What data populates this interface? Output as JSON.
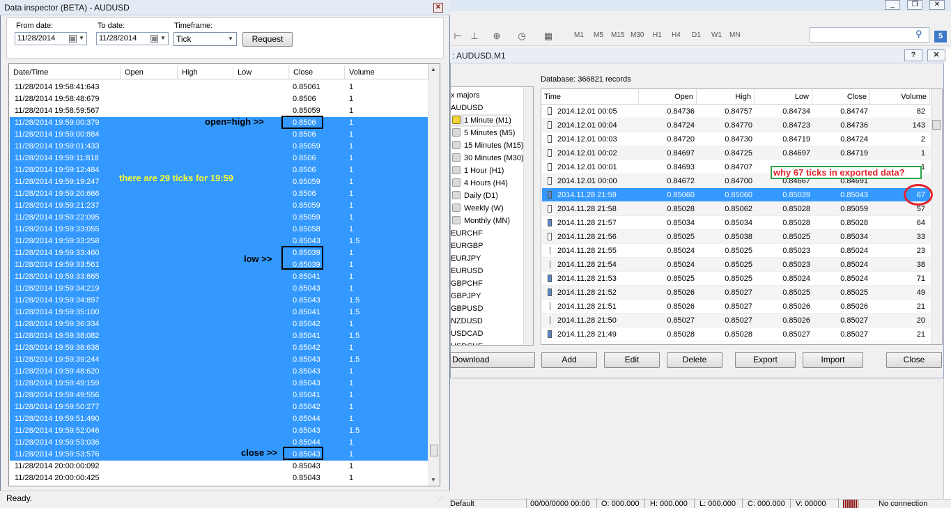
{
  "inspector": {
    "title": "Data inspector (BETA) -  AUDUSD",
    "from_label": "From date:",
    "from_value": "11/28/2014",
    "to_label": "To date:",
    "to_value": "11/28/2014",
    "timeframe_label": "Timeframe:",
    "timeframe_value": "Tick",
    "request_label": "Request",
    "columns": [
      "Date/Time",
      "Open",
      "High",
      "Low",
      "Close",
      "Volume"
    ],
    "rows": [
      {
        "time": "11/28/2014 19:58:41:643",
        "close": "0.85061",
        "volume": "1",
        "selected": false
      },
      {
        "time": "11/28/2014 19:58:48:679",
        "close": "0.8506",
        "volume": "1",
        "selected": false
      },
      {
        "time": "11/28/2014 19:58:59:567",
        "close": "0.85059",
        "volume": "1",
        "selected": false
      },
      {
        "time": "11/28/2014 19:59:00:379",
        "close": "0.8506",
        "volume": "1",
        "selected": true
      },
      {
        "time": "11/28/2014 19:59:00:884",
        "close": "0.8506",
        "volume": "1",
        "selected": true
      },
      {
        "time": "11/28/2014 19:59:01:433",
        "close": "0.85059",
        "volume": "1",
        "selected": true
      },
      {
        "time": "11/28/2014 19:59:11:818",
        "close": "0.8506",
        "volume": "1",
        "selected": true
      },
      {
        "time": "11/28/2014 19:59:12:484",
        "close": "0.8506",
        "volume": "1",
        "selected": true
      },
      {
        "time": "11/28/2014 19:59:19:247",
        "close": "0.85059",
        "volume": "1",
        "selected": true
      },
      {
        "time": "11/28/2014 19:59:20:666",
        "close": "0.8506",
        "volume": "1",
        "selected": true
      },
      {
        "time": "11/28/2014 19:59:21:237",
        "close": "0.85059",
        "volume": "1",
        "selected": true
      },
      {
        "time": "11/28/2014 19:59:22:095",
        "close": "0.85059",
        "volume": "1",
        "selected": true
      },
      {
        "time": "11/28/2014 19:59:33:055",
        "close": "0.85058",
        "volume": "1",
        "selected": true
      },
      {
        "time": "11/28/2014 19:59:33:258",
        "close": "0.85043",
        "volume": "1.5",
        "selected": true
      },
      {
        "time": "11/28/2014 19:59:33:460",
        "close": "0.85039",
        "volume": "1",
        "selected": true
      },
      {
        "time": "11/28/2014 19:59:33:561",
        "close": "0.85039",
        "volume": "1",
        "selected": true
      },
      {
        "time": "11/28/2014 19:59:33:865",
        "close": "0.85041",
        "volume": "1",
        "selected": true
      },
      {
        "time": "11/28/2014 19:59:34:219",
        "close": "0.85043",
        "volume": "1",
        "selected": true
      },
      {
        "time": "11/28/2014 19:59:34:897",
        "close": "0.85043",
        "volume": "1.5",
        "selected": true
      },
      {
        "time": "11/28/2014 19:59:35:100",
        "close": "0.85041",
        "volume": "1.5",
        "selected": true
      },
      {
        "time": "11/28/2014 19:59:36:334",
        "close": "0.85042",
        "volume": "1",
        "selected": true
      },
      {
        "time": "11/28/2014 19:59:38:082",
        "close": "0.85041",
        "volume": "1.5",
        "selected": true
      },
      {
        "time": "11/28/2014 19:59:38:638",
        "close": "0.85042",
        "volume": "1",
        "selected": true
      },
      {
        "time": "11/28/2014 19:59:39:244",
        "close": "0.85043",
        "volume": "1.5",
        "selected": true
      },
      {
        "time": "11/28/2014 19:59:48:620",
        "close": "0.85043",
        "volume": "1",
        "selected": true
      },
      {
        "time": "11/28/2014 19:59:49:159",
        "close": "0.85043",
        "volume": "1",
        "selected": true
      },
      {
        "time": "11/28/2014 19:59:49:556",
        "close": "0.85041",
        "volume": "1",
        "selected": true
      },
      {
        "time": "11/28/2014 19:59:50:277",
        "close": "0.85042",
        "volume": "1",
        "selected": true
      },
      {
        "time": "11/28/2014 19:59:51:490",
        "close": "0.85044",
        "volume": "1",
        "selected": true
      },
      {
        "time": "11/28/2014 19:59:52:046",
        "close": "0.85043",
        "volume": "1.5",
        "selected": true
      },
      {
        "time": "11/28/2014 19:59:53:036",
        "close": "0.85044",
        "volume": "1",
        "selected": true
      },
      {
        "time": "11/28/2014 19:59:53:576",
        "close": "0.85043",
        "volume": "1",
        "selected": true
      },
      {
        "time": "11/28/2014 20:00:00:092",
        "close": "0.85043",
        "volume": "1",
        "selected": false
      },
      {
        "time": "11/28/2014 20:00:00:425",
        "close": "0.85043",
        "volume": "1",
        "selected": false
      }
    ],
    "annotations": {
      "open_high": "open=high  >>",
      "ticks_note": "there are 29 ticks for 19:59",
      "low": "low >>",
      "close": "close >>"
    },
    "status": "Ready."
  },
  "history": {
    "title": ": AUDUSD,M1",
    "help_label": "?",
    "close_x": "✕",
    "db_info": "Database: 366821 records",
    "tree": [
      {
        "label": "x majors",
        "icon": false,
        "active": false,
        "selected": false
      },
      {
        "label": "AUDUSD",
        "icon": false,
        "active": false,
        "selected": false
      },
      {
        "label": "1 Minute (M1)",
        "icon": true,
        "active": true,
        "selected": true
      },
      {
        "label": "5 Minutes (M5)",
        "icon": true,
        "active": false,
        "selected": false
      },
      {
        "label": "15 Minutes (M15)",
        "icon": true,
        "active": false,
        "selected": false
      },
      {
        "label": "30 Minutes (M30)",
        "icon": true,
        "active": false,
        "selected": false
      },
      {
        "label": "1 Hour (H1)",
        "icon": true,
        "active": false,
        "selected": false
      },
      {
        "label": "4 Hours (H4)",
        "icon": true,
        "active": false,
        "selected": false
      },
      {
        "label": "Daily (D1)",
        "icon": true,
        "active": false,
        "selected": false
      },
      {
        "label": "Weekly (W)",
        "icon": true,
        "active": false,
        "selected": false
      },
      {
        "label": "Monthly (MN)",
        "icon": true,
        "active": false,
        "selected": false
      },
      {
        "label": "EURCHF",
        "icon": false,
        "active": false,
        "selected": false
      },
      {
        "label": "EURGBP",
        "icon": false,
        "active": false,
        "selected": false
      },
      {
        "label": "EURJPY",
        "icon": false,
        "active": false,
        "selected": false
      },
      {
        "label": "EURUSD",
        "icon": false,
        "active": false,
        "selected": false
      },
      {
        "label": "GBPCHF",
        "icon": false,
        "active": false,
        "selected": false
      },
      {
        "label": "GBPJPY",
        "icon": false,
        "active": false,
        "selected": false
      },
      {
        "label": "GBPUSD",
        "icon": false,
        "active": false,
        "selected": false
      },
      {
        "label": "NZDUSD",
        "icon": false,
        "active": false,
        "selected": false
      },
      {
        "label": "USDCAD",
        "icon": false,
        "active": false,
        "selected": false
      },
      {
        "label": "USDCHF",
        "icon": false,
        "active": false,
        "selected": false
      }
    ],
    "columns": [
      "Time",
      "Open",
      "High",
      "Low",
      "Close",
      "Volume"
    ],
    "rows": [
      {
        "time": "2014.12.01 00:05",
        "open": "0.84736",
        "high": "0.84757",
        "low": "0.84734",
        "close": "0.84747",
        "volume": "82",
        "candle": "up"
      },
      {
        "time": "2014.12.01 00:04",
        "open": "0.84724",
        "high": "0.84770",
        "low": "0.84723",
        "close": "0.84736",
        "volume": "143",
        "candle": "up"
      },
      {
        "time": "2014.12.01 00:03",
        "open": "0.84720",
        "high": "0.84730",
        "low": "0.84719",
        "close": "0.84724",
        "volume": "2",
        "candle": "up"
      },
      {
        "time": "2014.12.01 00:02",
        "open": "0.84697",
        "high": "0.84725",
        "low": "0.84697",
        "close": "0.84719",
        "volume": "1",
        "candle": "up"
      },
      {
        "time": "2014.12.01 00:01",
        "open": "0.84693",
        "high": "0.84707",
        "low": "",
        "close": "",
        "volume": "1",
        "candle": "up"
      },
      {
        "time": "2014.12.01 00:00",
        "open": "0.84672",
        "high": "0.84700",
        "low": "0.84667",
        "close": "0.84691",
        "volume": "",
        "candle": "up"
      },
      {
        "time": "2014.11.28 21:59",
        "open": "0.85060",
        "high": "0.85060",
        "low": "0.85039",
        "close": "0.85043",
        "volume": "67",
        "candle": "dark",
        "selected": true
      },
      {
        "time": "2014.11.28 21:58",
        "open": "0.85028",
        "high": "0.85062",
        "low": "0.85028",
        "close": "0.85059",
        "volume": "57",
        "candle": "up"
      },
      {
        "time": "2014.11.28 21:57",
        "open": "0.85034",
        "high": "0.85034",
        "low": "0.85028",
        "close": "0.85028",
        "volume": "64",
        "candle": "dark"
      },
      {
        "time": "2014.11.28 21:56",
        "open": "0.85025",
        "high": "0.85038",
        "low": "0.85025",
        "close": "0.85034",
        "volume": "33",
        "candle": "up"
      },
      {
        "time": "2014.11.28 21:55",
        "open": "0.85024",
        "high": "0.85025",
        "low": "0.85023",
        "close": "0.85024",
        "volume": "23",
        "candle": "line"
      },
      {
        "time": "2014.11.28 21:54",
        "open": "0.85024",
        "high": "0.85025",
        "low": "0.85023",
        "close": "0.85024",
        "volume": "38",
        "candle": "line"
      },
      {
        "time": "2014.11.28 21:53",
        "open": "0.85025",
        "high": "0.85025",
        "low": "0.85024",
        "close": "0.85024",
        "volume": "71",
        "candle": "dark"
      },
      {
        "time": "2014.11.28 21:52",
        "open": "0.85026",
        "high": "0.85027",
        "low": "0.85025",
        "close": "0.85025",
        "volume": "49",
        "candle": "dark"
      },
      {
        "time": "2014.11.28 21:51",
        "open": "0.85026",
        "high": "0.85027",
        "low": "0.85026",
        "close": "0.85026",
        "volume": "21",
        "candle": "line"
      },
      {
        "time": "2014.11.28 21:50",
        "open": "0.85027",
        "high": "0.85027",
        "low": "0.85026",
        "close": "0.85027",
        "volume": "20",
        "candle": "line"
      },
      {
        "time": "2014.11.28 21:49",
        "open": "0.85028",
        "high": "0.85028",
        "low": "0.85027",
        "close": "0.85027",
        "volume": "21",
        "candle": "dark"
      }
    ],
    "buttons": {
      "download": "Download",
      "add": "Add",
      "edit": "Edit",
      "delete": "Delete",
      "export": "Export",
      "import": "Import",
      "close": "Close"
    },
    "annotation": "why 67 ticks in exported data?"
  },
  "toolbar": {
    "timeframes": [
      "M1",
      "M5",
      "M15",
      "M30",
      "H1",
      "H4",
      "D1",
      "W1",
      "MN"
    ],
    "badge": "5"
  },
  "statusbar": {
    "profile": "Default",
    "datetime": "00/00/0000 00:00",
    "open": "O: 000.000",
    "high": "H: 000.000",
    "low": "L: 000.000",
    "close": "C: 000.000",
    "volume": "V: 00000",
    "connection": "No connection"
  },
  "colors": {
    "selection": "#3399ff",
    "annotation_yellow": "#ffff33",
    "annotation_red": "#e0262c",
    "annotation_green": "#2ea34a"
  }
}
